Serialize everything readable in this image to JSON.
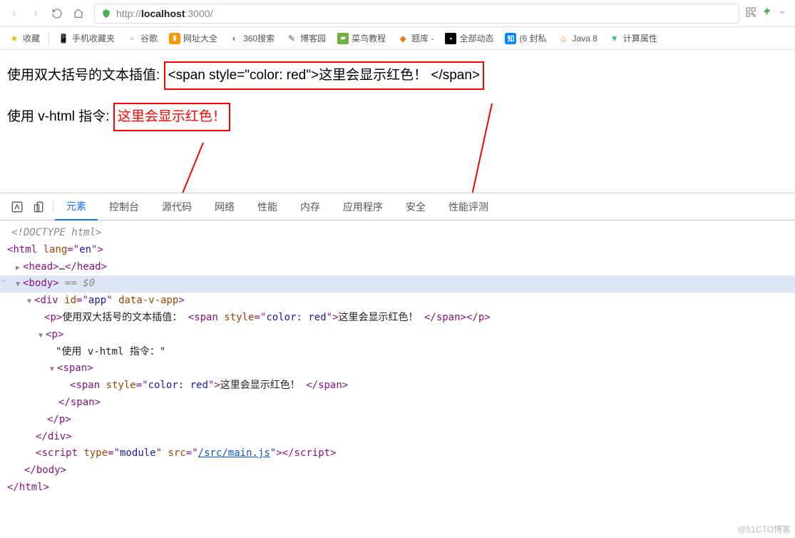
{
  "browser": {
    "url_proto": "http://",
    "url_host": "localhost",
    "url_port": ":3000/",
    "bookmarks": {
      "fav": "收藏",
      "mobile": "手机收藏夹",
      "google": "谷歌",
      "wangzhi": "网址大全",
      "sousuo": "360搜索",
      "boke": "博客园",
      "cainiao": "菜鸟教程",
      "tiku": "题库 -",
      "dongdai": "全部动态",
      "zhihu": "(6 封私",
      "java": "Java  8",
      "vue": "计算属性"
    }
  },
  "page": {
    "line1_label": "使用双大括号的文本插值: ",
    "line1_box": "<span style=\"color: red\">这里会显示红色！ </span>",
    "line2_label": "使用 v-html 指令: ",
    "line2_box": "这里会显示红色！"
  },
  "devtools": {
    "tabs": {
      "elements": "元素",
      "console": "控制台",
      "sources": "源代码",
      "network": "网络",
      "performance": "性能",
      "memory": "内存",
      "application": "应用程序",
      "security": "安全",
      "perf_eval": "性能评测"
    },
    "tree": {
      "doctype": "<!DOCTYPE html>",
      "html_open": "html",
      "html_lang_n": "lang",
      "html_lang_v": "en",
      "head": "head",
      "head_ellipsis": "…",
      "body": "body",
      "body_sel": " == $0",
      "div": "div",
      "div_id_n": "id",
      "div_id_v": "app",
      "div_attr": "data-v-app",
      "p1_text": "使用双大括号的文本插值：",
      "p1_span": "span",
      "p1_style_n": "style",
      "p1_style_v": "color: red",
      "p1_inner": "这里会显示红色！",
      "p2": "p",
      "p2_text": "\"使用 v-html 指令：\"",
      "p2_span": "span",
      "p2_span_inner": "span",
      "p2_inner_style_n": "style",
      "p2_inner_style_v": "color: red",
      "p2_inner_text": "这里会显示红色！",
      "script": "script",
      "script_type_n": "type",
      "script_type_v": "module",
      "script_src_n": "src",
      "script_src_v": "/src/main.js"
    }
  },
  "watermark": "@51CTO博客"
}
